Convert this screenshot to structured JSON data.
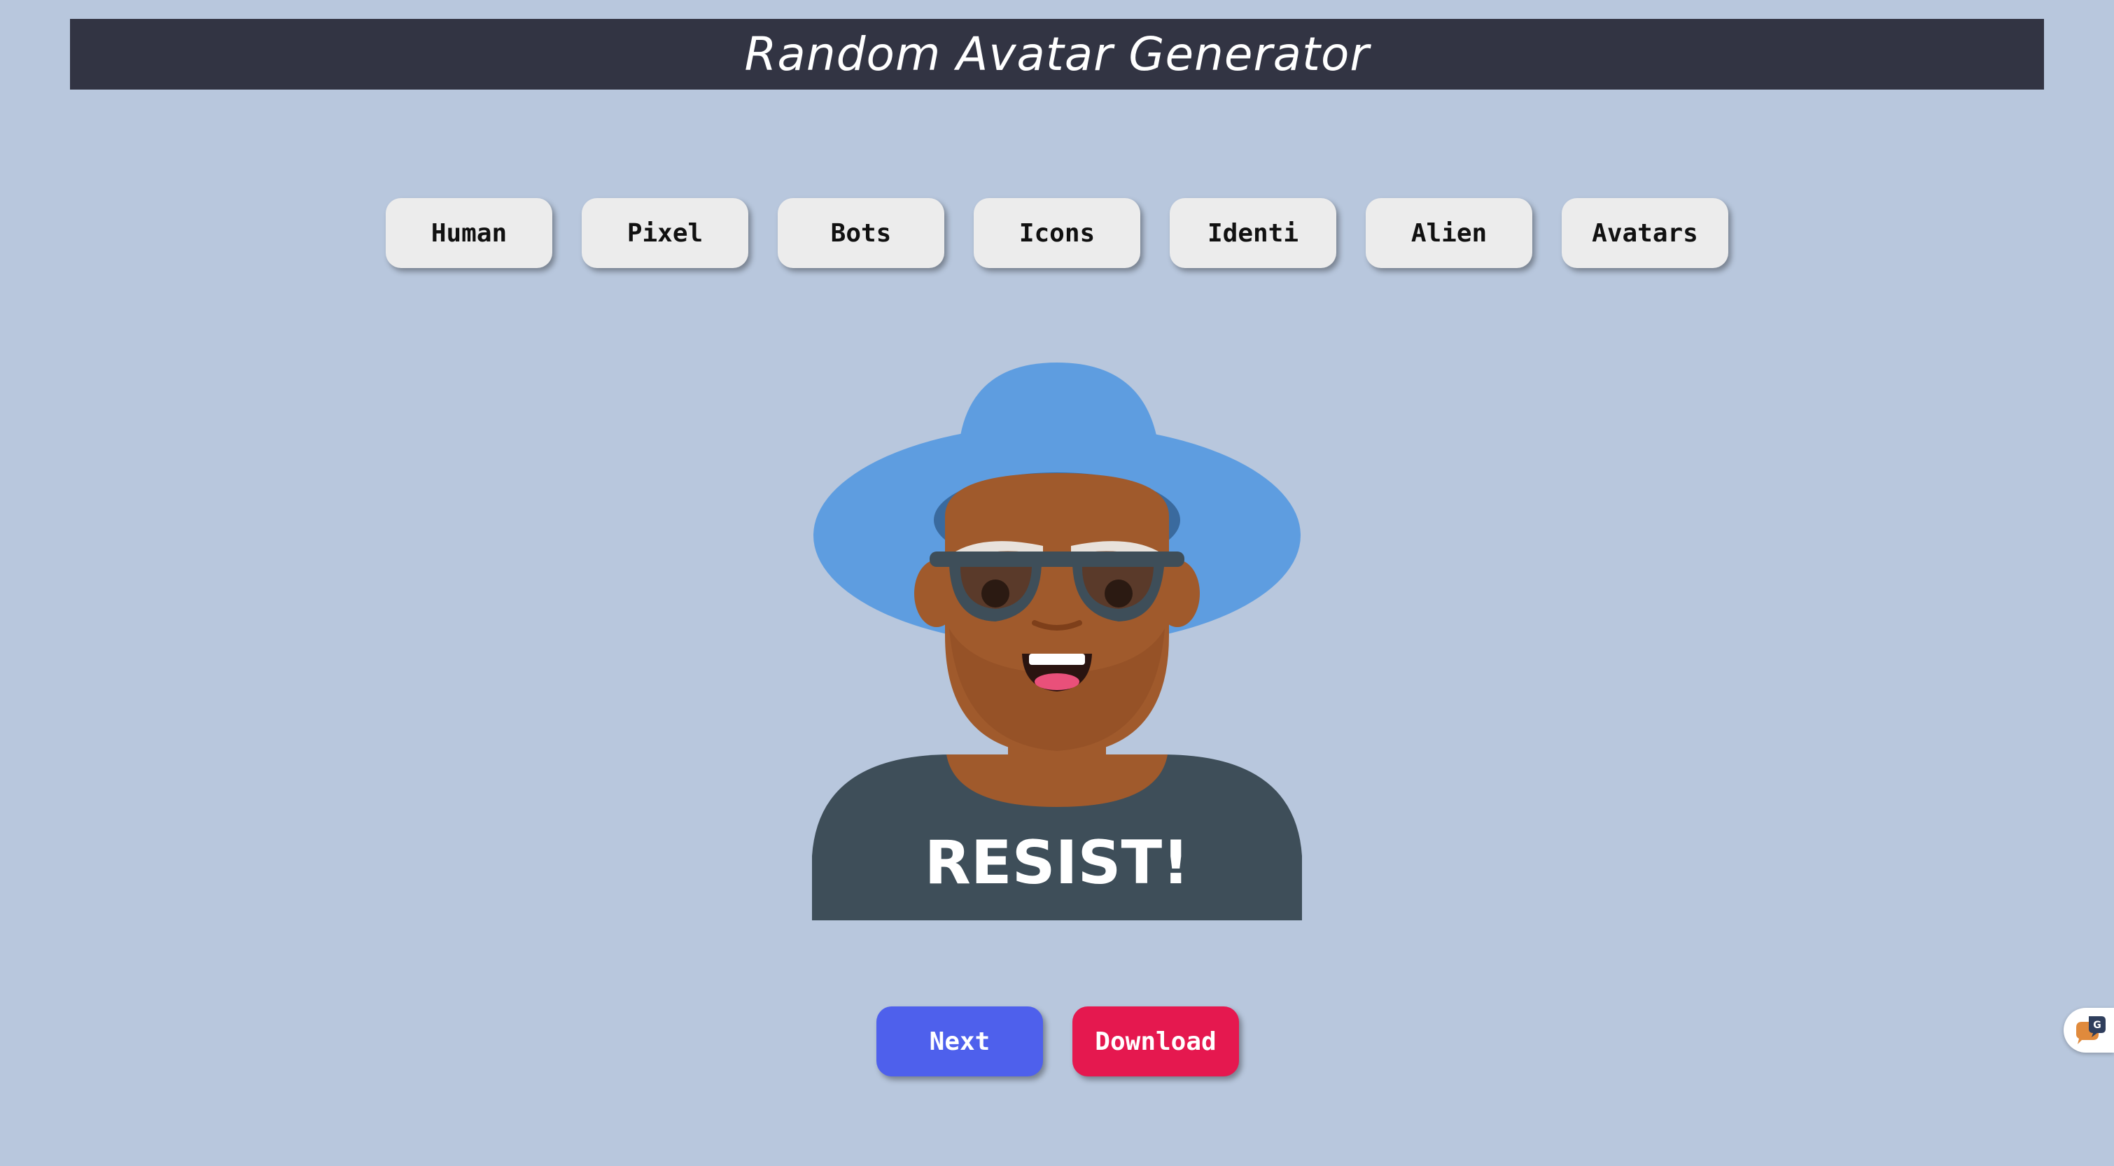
{
  "header": {
    "title": "Random Avatar Generator"
  },
  "categories": [
    {
      "label": "Human"
    },
    {
      "label": "Pixel"
    },
    {
      "label": "Bots"
    },
    {
      "label": "Icons"
    },
    {
      "label": "Identi"
    },
    {
      "label": "Alien"
    },
    {
      "label": "Avatars"
    }
  ],
  "avatar": {
    "shirt_text": "RESIST!",
    "colors": {
      "hat": "#5e9de0",
      "skin": "#a05a2c",
      "shirt": "#3e4e59",
      "glasses": "#3e4e59"
    }
  },
  "actions": {
    "next_label": "Next",
    "download_label": "Download"
  },
  "colors": {
    "background": "#b8c7dd",
    "header": "#323443",
    "next": "#4e60ec",
    "download": "#e5184f"
  },
  "widget": {
    "icon": "chat-icon"
  }
}
